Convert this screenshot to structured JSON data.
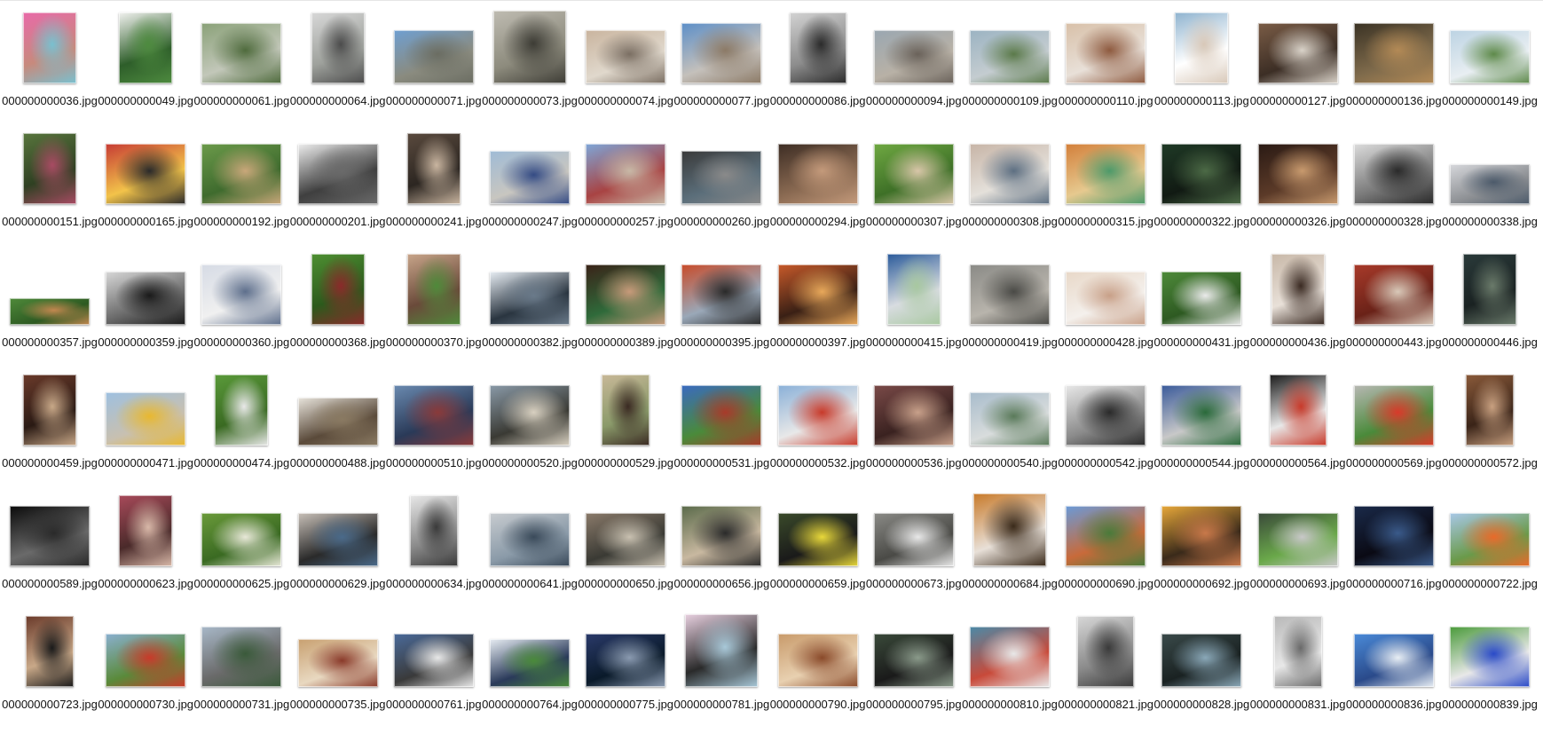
{
  "view": {
    "mode": "large-icons"
  },
  "files": [
    {
      "name": "000000000036.jpg",
      "aspect": 0.75,
      "colors": [
        "#e86aa8",
        "#79c0cf",
        "#c78a7d"
      ]
    },
    {
      "name": "000000000049.jpg",
      "aspect": 0.75,
      "colors": [
        "#f2f2f0",
        "#4e8b3f",
        "#2e5e2a"
      ]
    },
    {
      "name": "000000000061.jpg",
      "aspect": 1.333,
      "colors": [
        "#8aa178",
        "#4f6b3d",
        "#c2c7b9"
      ]
    },
    {
      "name": "000000000064.jpg",
      "aspect": 0.75,
      "colors": [
        "#d8d8d8",
        "#4c4c4c",
        "#9ea19c"
      ]
    },
    {
      "name": "000000000071.jpg",
      "aspect": 1.5,
      "colors": [
        "#6f9fd1",
        "#6b6d62",
        "#8a8b7f"
      ]
    },
    {
      "name": "000000000073.jpg",
      "aspect": 1.0,
      "colors": [
        "#bfbcb2",
        "#3d3c35",
        "#8d8b7d"
      ]
    },
    {
      "name": "000000000074.jpg",
      "aspect": 1.5,
      "colors": [
        "#c9b49e",
        "#7b6f63",
        "#e0d8cc"
      ]
    },
    {
      "name": "000000000077.jpg",
      "aspect": 1.333,
      "colors": [
        "#5d8fc8",
        "#8c7a66",
        "#c4c0bb"
      ]
    },
    {
      "name": "000000000086.jpg",
      "aspect": 0.8,
      "colors": [
        "#d3d3d3",
        "#2b2b2b",
        "#8c8c8c"
      ]
    },
    {
      "name": "000000000094.jpg",
      "aspect": 1.5,
      "colors": [
        "#9aa7b1",
        "#6a625a",
        "#b8b1a6"
      ]
    },
    {
      "name": "000000000109.jpg",
      "aspect": 1.5,
      "colors": [
        "#9bb3c2",
        "#5b7a4a",
        "#c4ccd0"
      ]
    },
    {
      "name": "000000000110.jpg",
      "aspect": 1.333,
      "colors": [
        "#d8c0a8",
        "#8e5a3f",
        "#e8e0d8"
      ]
    },
    {
      "name": "000000000113.jpg",
      "aspect": 0.75,
      "colors": [
        "#8fb3cf",
        "#d8c8b8",
        "#ffffff"
      ]
    },
    {
      "name": "000000000127.jpg",
      "aspect": 1.333,
      "colors": [
        "#7a5c46",
        "#d9d2c8",
        "#3c2e25"
      ]
    },
    {
      "name": "000000000136.jpg",
      "aspect": 1.333,
      "colors": [
        "#3a3224",
        "#b38a56",
        "#7e6a4b"
      ]
    },
    {
      "name": "000000000149.jpg",
      "aspect": 1.5,
      "colors": [
        "#bcd3e3",
        "#5e8a4a",
        "#e8eef2"
      ]
    },
    {
      "name": "000000000151.jpg",
      "aspect": 0.75,
      "colors": [
        "#58753d",
        "#a84b63",
        "#2f4022"
      ]
    },
    {
      "name": "000000000165.jpg",
      "aspect": 1.333,
      "colors": [
        "#c63b34",
        "#2a2a2a",
        "#f2c34a"
      ]
    },
    {
      "name": "000000000192.jpg",
      "aspect": 1.333,
      "colors": [
        "#6b9a4a",
        "#c9a77a",
        "#3f6b2e"
      ]
    },
    {
      "name": "000000000201.jpg",
      "aspect": 1.333,
      "colors": [
        "#eeeeee",
        "#6a6a6a",
        "#3f3f3f"
      ]
    },
    {
      "name": "000000000241.jpg",
      "aspect": 0.75,
      "colors": [
        "#5a4a3e",
        "#c9b5a0",
        "#2c2621"
      ]
    },
    {
      "name": "000000000247.jpg",
      "aspect": 1.5,
      "colors": [
        "#9fbbd6",
        "#344b84",
        "#c8c6c0"
      ]
    },
    {
      "name": "000000000257.jpg",
      "aspect": 1.333,
      "colors": [
        "#7ea6d8",
        "#c8b8a6",
        "#a84343"
      ]
    },
    {
      "name": "000000000260.jpg",
      "aspect": 1.5,
      "colors": [
        "#3a3a3a",
        "#8a8a8a",
        "#5b6e7a"
      ]
    },
    {
      "name": "000000000294.jpg",
      "aspect": 1.333,
      "colors": [
        "#3d2d24",
        "#c49a7b",
        "#8a6a52"
      ]
    },
    {
      "name": "000000000307.jpg",
      "aspect": 1.333,
      "colors": [
        "#6fa842",
        "#d8c6a8",
        "#3e7027"
      ]
    },
    {
      "name": "000000000308.jpg",
      "aspect": 1.333,
      "colors": [
        "#c7b4a6",
        "#5d6f82",
        "#e4e0da"
      ]
    },
    {
      "name": "000000000315.jpg",
      "aspect": 1.333,
      "colors": [
        "#d37f3a",
        "#4d9a6a",
        "#e6c98f"
      ]
    },
    {
      "name": "000000000322.jpg",
      "aspect": 1.333,
      "colors": [
        "#1f3a26",
        "#4c6a46",
        "#111a13"
      ]
    },
    {
      "name": "000000000326.jpg",
      "aspect": 1.333,
      "colors": [
        "#2a1a14",
        "#c89a6e",
        "#5b3a28"
      ]
    },
    {
      "name": "000000000328.jpg",
      "aspect": 1.333,
      "colors": [
        "#dcdcdc",
        "#2a2a2a",
        "#7a7a7a"
      ]
    },
    {
      "name": "000000000338.jpg",
      "aspect": 2.0,
      "colors": [
        "#d7d8dc",
        "#4c5a6a",
        "#8b8e92"
      ]
    },
    {
      "name": "000000000357.jpg",
      "aspect": 3.0,
      "colors": [
        "#4f8a3a",
        "#c2874f",
        "#2d5a22"
      ]
    },
    {
      "name": "000000000359.jpg",
      "aspect": 1.5,
      "colors": [
        "#d8d8d8",
        "#1a1a1a",
        "#6a6a6a"
      ]
    },
    {
      "name": "000000000360.jpg",
      "aspect": 1.333,
      "colors": [
        "#d6dbe5",
        "#5e6f8c",
        "#f0f0f0"
      ]
    },
    {
      "name": "000000000368.jpg",
      "aspect": 0.75,
      "colors": [
        "#4e8f32",
        "#8a2a2a",
        "#2c5a1c"
      ]
    },
    {
      "name": "000000000370.jpg",
      "aspect": 0.75,
      "colors": [
        "#c8a58a",
        "#4f8a3a",
        "#6a4a3a"
      ]
    },
    {
      "name": "000000000382.jpg",
      "aspect": 1.5,
      "colors": [
        "#e8eef4",
        "#6a7a8a",
        "#2a3540"
      ]
    },
    {
      "name": "000000000389.jpg",
      "aspect": 1.333,
      "colors": [
        "#3a2218",
        "#c79a7a",
        "#2f6a3a"
      ]
    },
    {
      "name": "000000000395.jpg",
      "aspect": 1.333,
      "colors": [
        "#c84b2a",
        "#2a2a2a",
        "#9aa8b8"
      ]
    },
    {
      "name": "000000000397.jpg",
      "aspect": 1.333,
      "colors": [
        "#c85a2a",
        "#e8a85a",
        "#3a2015"
      ]
    },
    {
      "name": "000000000415.jpg",
      "aspect": 0.75,
      "colors": [
        "#2a5a9a",
        "#a8c8a0",
        "#d8dce0"
      ]
    },
    {
      "name": "000000000419.jpg",
      "aspect": 1.333,
      "colors": [
        "#8a8a86",
        "#4a4a46",
        "#b8b4ac"
      ]
    },
    {
      "name": "000000000428.jpg",
      "aspect": 1.5,
      "colors": [
        "#e8d8c8",
        "#c8a088",
        "#f4f0ec"
      ]
    },
    {
      "name": "000000000431.jpg",
      "aspect": 1.5,
      "colors": [
        "#4e8a3a",
        "#eaeaea",
        "#2e5a22"
      ]
    },
    {
      "name": "000000000436.jpg",
      "aspect": 0.75,
      "colors": [
        "#c8b8a8",
        "#3a2a22",
        "#e8e0d8"
      ]
    },
    {
      "name": "000000000443.jpg",
      "aspect": 1.333,
      "colors": [
        "#a83a2a",
        "#d8c8b8",
        "#6a2218"
      ]
    },
    {
      "name": "000000000446.jpg",
      "aspect": 0.75,
      "colors": [
        "#2a3a3a",
        "#6a7a6a",
        "#1a2222"
      ]
    },
    {
      "name": "000000000459.jpg",
      "aspect": 0.75,
      "colors": [
        "#6a3a2a",
        "#c8a888",
        "#2a1a14"
      ]
    },
    {
      "name": "000000000471.jpg",
      "aspect": 1.5,
      "colors": [
        "#9ec0e0",
        "#e8b830",
        "#c8c0b0"
      ]
    },
    {
      "name": "000000000474.jpg",
      "aspect": 0.75,
      "colors": [
        "#5a9a3a",
        "#e8e8e8",
        "#3a6a22"
      ]
    },
    {
      "name": "000000000488.jpg",
      "aspect": 1.667,
      "colors": [
        "#e8e4dc",
        "#8a7a62",
        "#5a4a3a"
      ]
    },
    {
      "name": "000000000510.jpg",
      "aspect": 1.333,
      "colors": [
        "#6a8ab0",
        "#8a3a3a",
        "#2a3a58"
      ]
    },
    {
      "name": "000000000520.jpg",
      "aspect": 1.333,
      "colors": [
        "#8a9aa8",
        "#d8d0c0",
        "#3a3a34"
      ]
    },
    {
      "name": "000000000529.jpg",
      "aspect": 0.67,
      "colors": [
        "#c8b898",
        "#3a2a22",
        "#8a9a6a"
      ]
    },
    {
      "name": "000000000531.jpg",
      "aspect": 1.333,
      "colors": [
        "#3a6ac0",
        "#a83a2a",
        "#4a8a3a"
      ]
    },
    {
      "name": "000000000532.jpg",
      "aspect": 1.333,
      "colors": [
        "#8ab0d8",
        "#c83a2a",
        "#e8e8e8"
      ]
    },
    {
      "name": "000000000536.jpg",
      "aspect": 1.333,
      "colors": [
        "#7a4a48",
        "#c8a08a",
        "#3a2220"
      ]
    },
    {
      "name": "000000000540.jpg",
      "aspect": 1.5,
      "colors": [
        "#a8bccc",
        "#5a7a5a",
        "#d8dcdc"
      ]
    },
    {
      "name": "000000000542.jpg",
      "aspect": 1.333,
      "colors": [
        "#e8e8e8",
        "#2a2a2a",
        "#8a8a8a"
      ]
    },
    {
      "name": "000000000544.jpg",
      "aspect": 1.333,
      "colors": [
        "#3a5a9a",
        "#2a6a3a",
        "#c8c8c8"
      ]
    },
    {
      "name": "000000000564.jpg",
      "aspect": 0.8,
      "colors": [
        "#1a1a1a",
        "#c83a2a",
        "#e8e8e8"
      ]
    },
    {
      "name": "000000000569.jpg",
      "aspect": 1.333,
      "colors": [
        "#b8b8b4",
        "#d83a2a",
        "#4a8a3a"
      ]
    },
    {
      "name": "000000000572.jpg",
      "aspect": 0.67,
      "colors": [
        "#8a5a3a",
        "#c8a080",
        "#3a2418"
      ]
    },
    {
      "name": "000000000589.jpg",
      "aspect": 1.333,
      "colors": [
        "#0a0a0a",
        "#2a2a2a",
        "#6a6a6a"
      ]
    },
    {
      "name": "000000000623.jpg",
      "aspect": 0.75,
      "colors": [
        "#a84a5a",
        "#d8b8a8",
        "#4a2a2a"
      ]
    },
    {
      "name": "000000000625.jpg",
      "aspect": 1.5,
      "colors": [
        "#6a9a3a",
        "#e8e8d8",
        "#3a6a22"
      ]
    },
    {
      "name": "000000000629.jpg",
      "aspect": 1.5,
      "colors": [
        "#c8c0b8",
        "#4a6a8a",
        "#2a2a2a"
      ]
    },
    {
      "name": "000000000634.jpg",
      "aspect": 0.67,
      "colors": [
        "#e8e8e8",
        "#3a3a3a",
        "#8a8a8a"
      ]
    },
    {
      "name": "000000000641.jpg",
      "aspect": 1.5,
      "colors": [
        "#c8ccd0",
        "#3a4a5a",
        "#8a9aa8"
      ]
    },
    {
      "name": "000000000650.jpg",
      "aspect": 1.5,
      "colors": [
        "#8a7a6a",
        "#c8c0b0",
        "#3a3a34"
      ]
    },
    {
      "name": "000000000656.jpg",
      "aspect": 1.333,
      "colors": [
        "#5a6a4a",
        "#2a2a2a",
        "#c8b8a0"
      ]
    },
    {
      "name": "000000000659.jpg",
      "aspect": 1.5,
      "colors": [
        "#3a4a2a",
        "#e8d83a",
        "#1a1a1a"
      ]
    },
    {
      "name": "000000000673.jpg",
      "aspect": 1.5,
      "colors": [
        "#8a8a86",
        "#e8e8e8",
        "#4a4a46"
      ]
    },
    {
      "name": "000000000684.jpg",
      "aspect": 1.0,
      "colors": [
        "#c87a2a",
        "#3a2a1a",
        "#e8e0d8"
      ]
    },
    {
      "name": "000000000690.jpg",
      "aspect": 1.333,
      "colors": [
        "#6a9ad8",
        "#4a7a3a",
        "#c86a3a"
      ]
    },
    {
      "name": "000000000692.jpg",
      "aspect": 1.333,
      "colors": [
        "#e8a83a",
        "#c8784a",
        "#3a2a1a"
      ]
    },
    {
      "name": "000000000693.jpg",
      "aspect": 1.5,
      "colors": [
        "#3a4a3a",
        "#c8c8c8",
        "#6aa84a"
      ]
    },
    {
      "name": "000000000716.jpg",
      "aspect": 1.333,
      "colors": [
        "#1a2a4a",
        "#3a5a8a",
        "#0a0a14"
      ]
    },
    {
      "name": "000000000722.jpg",
      "aspect": 1.5,
      "colors": [
        "#a8c8e8",
        "#e86a2a",
        "#6a9a4a"
      ]
    },
    {
      "name": "000000000723.jpg",
      "aspect": 0.67,
      "colors": [
        "#6a3a2a",
        "#1a1a1a",
        "#c8a888"
      ]
    },
    {
      "name": "000000000730.jpg",
      "aspect": 1.5,
      "colors": [
        "#8ab0d0",
        "#c83a2a",
        "#5a8a3a"
      ]
    },
    {
      "name": "000000000731.jpg",
      "aspect": 1.333,
      "colors": [
        "#a8b8c8",
        "#3a5a3a",
        "#6a6a6a"
      ]
    },
    {
      "name": "000000000735.jpg",
      "aspect": 1.667,
      "colors": [
        "#c8a070",
        "#8a3a2a",
        "#e8d8c0"
      ]
    },
    {
      "name": "000000000761.jpg",
      "aspect": 1.5,
      "colors": [
        "#4a6a9a",
        "#e8e8e8",
        "#3a3a3a"
      ]
    },
    {
      "name": "000000000764.jpg",
      "aspect": 1.667,
      "colors": [
        "#e8eef4",
        "#4a8a3a",
        "#2a3a5a"
      ]
    },
    {
      "name": "000000000775.jpg",
      "aspect": 1.5,
      "colors": [
        "#2a3a6a",
        "#8a9ab0",
        "#0a1a2a"
      ]
    },
    {
      "name": "000000000781.jpg",
      "aspect": 1.0,
      "colors": [
        "#e8d0e0",
        "#a8c8d8",
        "#2a2a2a"
      ]
    },
    {
      "name": "000000000790.jpg",
      "aspect": 1.5,
      "colors": [
        "#c89a6a",
        "#8a4a2a",
        "#e8d0b0"
      ]
    },
    {
      "name": "000000000795.jpg",
      "aspect": 1.5,
      "colors": [
        "#3a4a3a",
        "#8a9a8a",
        "#1a1a1a"
      ]
    },
    {
      "name": "000000000810.jpg",
      "aspect": 1.333,
      "colors": [
        "#4a8aa8",
        "#e8e8e8",
        "#c84a3a"
      ]
    },
    {
      "name": "000000000821.jpg",
      "aspect": 0.8,
      "colors": [
        "#d8d8d8",
        "#3a3a3a",
        "#8a8a8a"
      ]
    },
    {
      "name": "000000000828.jpg",
      "aspect": 1.5,
      "colors": [
        "#3a4a4a",
        "#8aa8b8",
        "#1a2222"
      ]
    },
    {
      "name": "000000000831.jpg",
      "aspect": 0.67,
      "colors": [
        "#b8b8b8",
        "#6a6a6a",
        "#e8e8e8"
      ]
    },
    {
      "name": "000000000836.jpg",
      "aspect": 1.5,
      "colors": [
        "#4a8ad8",
        "#e8eef4",
        "#2a4a8a"
      ]
    },
    {
      "name": "000000000839.jpg",
      "aspect": 1.333,
      "colors": [
        "#4a9a3a",
        "#2a4ac8",
        "#e8e8e8"
      ]
    }
  ]
}
